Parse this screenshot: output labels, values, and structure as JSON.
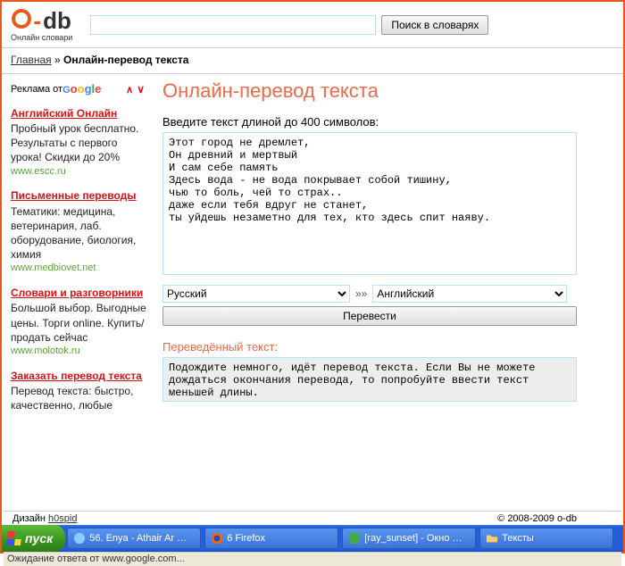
{
  "logo": {
    "subtitle": "Онлайн словари"
  },
  "search": {
    "placeholder": "",
    "button": "Поиск в словарях"
  },
  "breadcrumb": {
    "home": "Главная",
    "sep": " » ",
    "current": "Онлайн-перевод текста"
  },
  "ads": {
    "label": "Реклама от ",
    "google": [
      "G",
      "o",
      "o",
      "g",
      "l",
      "e"
    ],
    "arrows": {
      "prev": "∧",
      "next": "∨"
    },
    "items": [
      {
        "title": "Английский Онлайн",
        "desc": "Пробный урок бесплатно. Результаты с первого урока! Скидки до 20%",
        "url": "www.escc.ru"
      },
      {
        "title": "Письменные переводы",
        "desc": "Тематики: медицина, ветеринария, лаб. оборудование, биология, химия",
        "url": "www.medbiovet.net"
      },
      {
        "title": "Словари и разговорники",
        "desc": "Большой выбор. Выгодные цены. Торги online. Купить/продать сейчас",
        "url": "www.molotok.ru"
      },
      {
        "title": "Заказать перевод текста",
        "desc": "Перевод текста: быстро, качественно, любые",
        "url": ""
      }
    ]
  },
  "main": {
    "heading": "Онлайн-перевод текста",
    "input_label": "Введите текст длиной до 400 символов:",
    "input_value": "Этот город не дремлет,\nОн древний и мертвый\nИ сам себе память\nЗдесь вода - не вода покрывает собой тишину,\nчью то боль, чей то страх..\nдаже если тебя вдруг не станет,\nты уйдешь незаметно для тех, кто здесь спит наяву.",
    "lang_from": "Русский",
    "lang_to": "Английский",
    "chev": "»»",
    "translate": "Перевести",
    "output_label": "Переведённый текст:",
    "output_value": "Подождите немного, идёт перевод текста. Если Вы не можете дождаться окончания перевода, то попробуйте ввести текст меньшей длины."
  },
  "footer": {
    "design_label": "Дизайн ",
    "designer": "h0spid",
    "copyright": "© 2008-2009 o-db"
  },
  "status": "Ожидание ответа от www.google.com...",
  "taskbar": {
    "start": "пуск",
    "tasks": [
      {
        "label": "56. Enya - Athair Ar …",
        "icon": "music"
      },
      {
        "label": "6 Firefox",
        "icon": "firefox"
      },
      {
        "label": "[ray_sunset] - Окно …",
        "icon": "doc"
      },
      {
        "label": "Тексты",
        "icon": "folder"
      }
    ]
  }
}
